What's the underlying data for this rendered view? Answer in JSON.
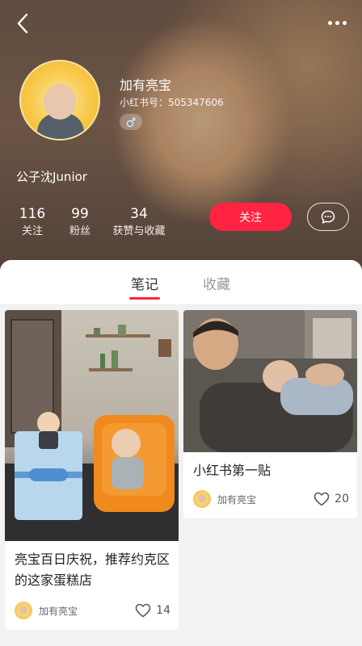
{
  "header": {
    "nickname": "加有亮宝",
    "red_id": "小红书号：505347606",
    "bio": "公子沈Junior",
    "gender_icon": "male-icon",
    "stats": [
      {
        "value": "116",
        "label": "关注"
      },
      {
        "value": "99",
        "label": "粉丝"
      },
      {
        "value": "34",
        "label": "获赞与收藏"
      }
    ],
    "follow_label": "关注"
  },
  "tabs": [
    {
      "label": "笔记",
      "active": true
    },
    {
      "label": "收藏",
      "active": false
    }
  ],
  "notes": [
    {
      "title": "亮宝百日庆祝，推荐约克区的这家蛋糕店",
      "author": "加有亮宝",
      "likes": "14"
    },
    {
      "title": "小红书第一贴",
      "author": "加有亮宝",
      "likes": "20"
    }
  ],
  "colors": {
    "accent": "#ff2442"
  }
}
